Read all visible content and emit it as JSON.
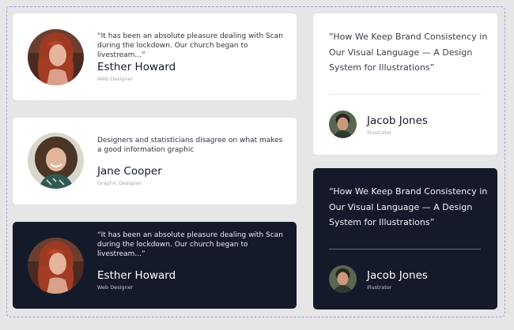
{
  "testimonials": [
    {
      "quote": "“It has been an absolute pleasure dealing with Scan during the lockdown. Our church began to livestream...”",
      "name": "Esther Howard",
      "role": "Web Designer",
      "avatar": "woman-red-hair-avatar"
    },
    {
      "quote": "Designers and statisticians disagree on what makes a good information graphic",
      "name": "Jane Cooper",
      "role": "Graphic Designer",
      "avatar": "woman-curly-hair-avatar"
    },
    {
      "quote": "“It has been an absolute pleasure dealing with Scan during the lockdown. Our church began to livestream...”",
      "name": "Esther Howard",
      "role": "Web Designer",
      "avatar": "woman-red-hair-avatar"
    }
  ],
  "articles": [
    {
      "title": "“How We Keep Brand Consistency in Our Visual Language — A Design System for Illustrations”",
      "author": "Jacob Jones",
      "role": "Illustrator",
      "avatar": "man-avatar"
    },
    {
      "title": "“How We Keep Brand Consistency in Our Visual Language — A Design System for Illustrations”",
      "author": "Jacob Jones",
      "role": "Illustrator",
      "avatar": "man-avatar"
    }
  ],
  "colors": {
    "background": "#e6e6e6",
    "card_light": "#ffffff",
    "card_dark": "#141a2a",
    "frame_border": "#a99bd8"
  }
}
